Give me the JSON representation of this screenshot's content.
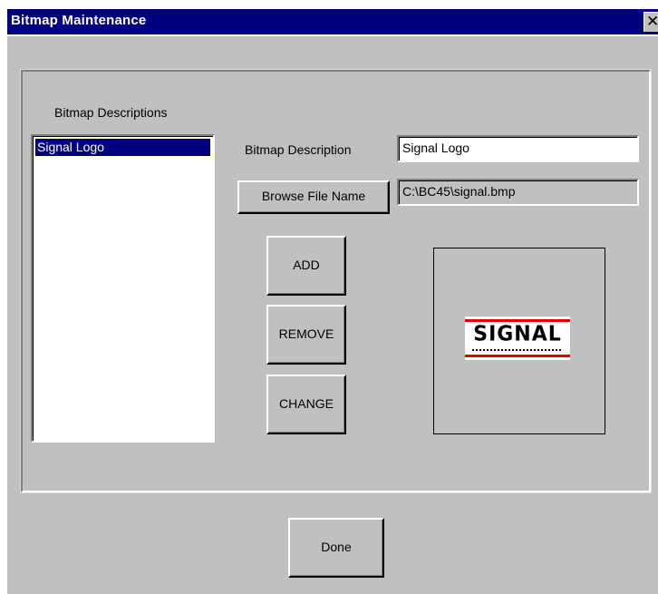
{
  "window": {
    "title": "Bitmap Maintenance",
    "close_glyph": "✕"
  },
  "list": {
    "header": "Bitmap Descriptions",
    "items": [
      "Signal Logo"
    ],
    "selected_index": 0
  },
  "form": {
    "description_label": "Bitmap Description",
    "description_value": "Signal Logo",
    "browse_label": "Browse File Name",
    "file_name_value": "C:\\BC45\\signal.bmp"
  },
  "actions": {
    "add_label": "ADD",
    "remove_label": "REMOVE",
    "change_label": "CHANGE"
  },
  "preview": {
    "logo_text": "SIGNAL",
    "logo_colors": {
      "bar": "#e00000",
      "text": "#000000"
    }
  },
  "footer": {
    "done_label": "Done"
  },
  "colors": {
    "titlebar": "#000080",
    "dialog": "#c0c0c0",
    "selection": "#000080"
  }
}
